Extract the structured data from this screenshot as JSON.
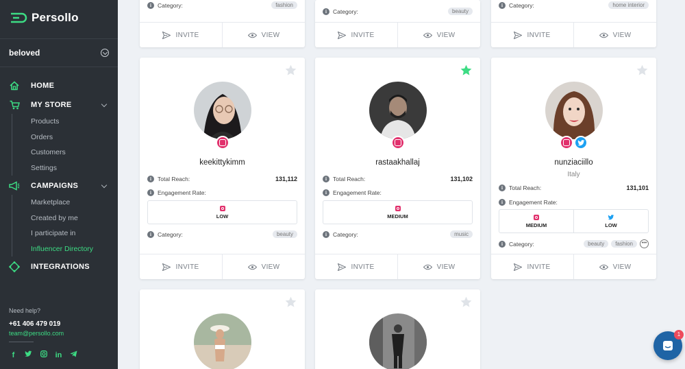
{
  "brand": {
    "name": "Persollo"
  },
  "store": {
    "name": "beloved"
  },
  "nav": {
    "home": "HOME",
    "my_store": "MY STORE",
    "store_items": [
      "Products",
      "Orders",
      "Customers",
      "Settings"
    ],
    "campaigns": "CAMPAIGNS",
    "campaign_items": [
      "Marketplace",
      "Created by me",
      "I participate in",
      "Influencer Directory"
    ],
    "integrations": "INTEGRATIONS"
  },
  "help": {
    "label": "Need help?",
    "phone": "+61 406 479 019",
    "email": "team@persollo.com"
  },
  "labels": {
    "total_reach": "Total Reach:",
    "engagement_rate": "Engagement Rate:",
    "category": "Category:",
    "invite": "INVITE",
    "view": "VIEW"
  },
  "top_cards": [
    {
      "tags": [
        "fashion"
      ]
    },
    {
      "tags": [
        "beauty"
      ]
    },
    {
      "tags": [
        "home interior"
      ]
    }
  ],
  "cards": [
    {
      "username": "keekittykimm",
      "reach": "131,112",
      "engagement": [
        "LOW"
      ],
      "tags": [
        "beauty"
      ],
      "starred": false
    },
    {
      "username": "rastaakhallaj",
      "reach": "131,102",
      "engagement": [
        "MEDIUM"
      ],
      "tags": [
        "music"
      ],
      "starred": true
    },
    {
      "username": "nunziaciillo",
      "country": "Italy",
      "reach": "131,101",
      "engagement": [
        "MEDIUM",
        "LOW"
      ],
      "tags": [
        "beauty",
        "fashion"
      ],
      "starred": false
    }
  ],
  "chat": {
    "badge": "1"
  },
  "colors": {
    "accent": "#3ddc84",
    "sidebar": "#2b3036",
    "instagram": "#e1306c",
    "twitter": "#1da1f2"
  }
}
